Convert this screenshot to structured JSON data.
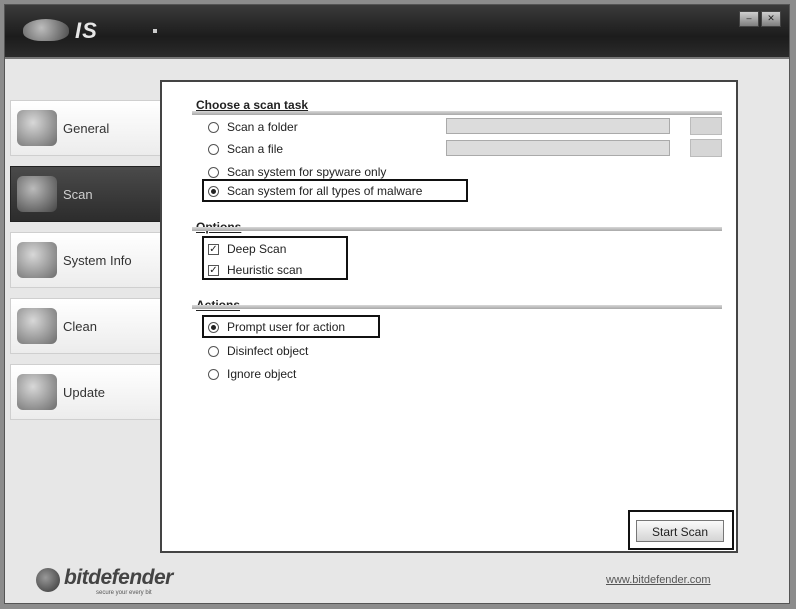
{
  "window": {
    "app_name": "IS",
    "buttons": [
      "–",
      "✕"
    ]
  },
  "sidebar": {
    "items": [
      {
        "label": "General",
        "icon": "general-icon",
        "active": false
      },
      {
        "label": "Scan",
        "icon": "scan-icon",
        "active": true
      },
      {
        "label": "System Info",
        "icon": "system-info-icon",
        "active": false
      },
      {
        "label": "Clean",
        "icon": "clean-icon",
        "active": false
      },
      {
        "label": "Update",
        "icon": "update-icon",
        "active": false
      }
    ]
  },
  "scan_task": {
    "title": "Choose a scan task",
    "options": [
      {
        "label": "Scan a folder",
        "selected": false
      },
      {
        "label": "Scan a file",
        "selected": false
      },
      {
        "label": "Scan system for spyware only",
        "selected": false
      },
      {
        "label": "Scan system for all types of malware",
        "selected": true
      }
    ]
  },
  "options": {
    "title": "Options",
    "items": [
      {
        "label": "Deep Scan",
        "checked": true
      },
      {
        "label": "Heuristic scan",
        "checked": true
      }
    ]
  },
  "actions": {
    "title": "Actions",
    "options": [
      {
        "label": "Prompt user for action",
        "selected": true
      },
      {
        "label": "Disinfect object",
        "selected": false
      },
      {
        "label": "Ignore object",
        "selected": false
      }
    ]
  },
  "start_button": {
    "label": "Start Scan"
  },
  "footer": {
    "brand": "bitdefender",
    "tagline": "secure your every bit",
    "website": "www.bitdefender.com"
  }
}
